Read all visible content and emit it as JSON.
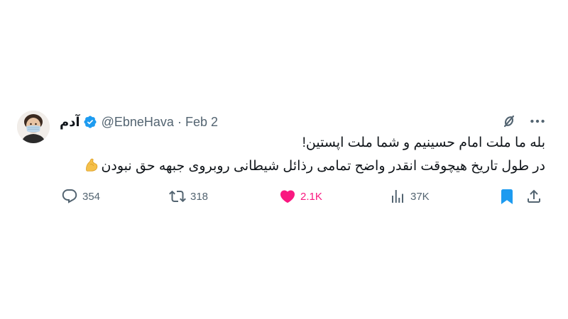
{
  "tweet": {
    "display_name": "آدم",
    "handle": "@EbneHava",
    "separator": "·",
    "date": "Feb 2",
    "text_line1": "بله ما ملت امام حسینیم و شما ملت اپستین!",
    "text_line2": "در طول تاریخ هیچوقت انقدر واضح تمامی رذائل شیطانی روبروی جبهه حق نبودن",
    "verified_icon": "verified-badge-icon",
    "emoji": "flexed-biceps"
  },
  "actions": {
    "replies": "354",
    "retweets": "318",
    "likes": "2.1K",
    "views": "37K"
  },
  "colors": {
    "text_primary": "#0f1419",
    "text_secondary": "#536471",
    "verified": "#1d9bf0",
    "like": "#f91880",
    "bookmark": "#1d9bf0"
  }
}
